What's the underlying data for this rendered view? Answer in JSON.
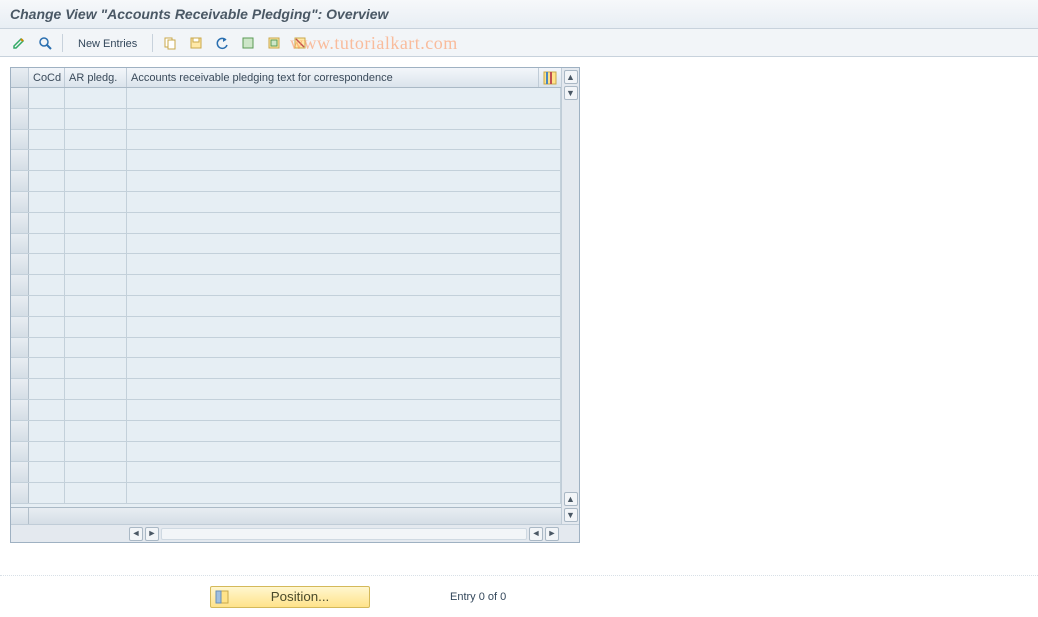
{
  "title": "Change View \"Accounts Receivable Pledging\": Overview",
  "watermark": "www.tutorialkart.com",
  "toolbar": {
    "new_entries_label": "New Entries"
  },
  "grid": {
    "columns": {
      "cocd": "CoCd",
      "ar_pledg": "AR pledg.",
      "text": "Accounts receivable pledging text for correspondence"
    },
    "row_count": 20
  },
  "footer": {
    "position_label": "Position...",
    "entry_text": "Entry 0 of 0"
  }
}
